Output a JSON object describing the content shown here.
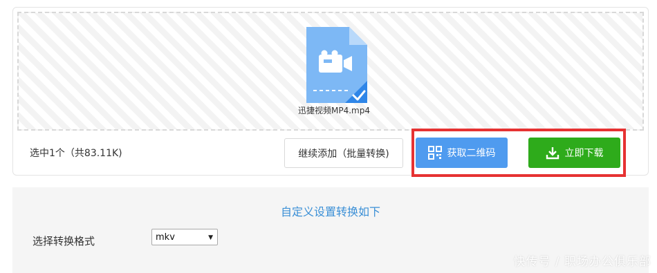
{
  "file": {
    "name": "迅捷视频MP4.mp4",
    "icon": "video-file-icon"
  },
  "status": {
    "selected_text": "选中1个（共83.11K)"
  },
  "buttons": {
    "add_more": "继续添加（批量转换)",
    "qr_code": "获取二维码",
    "download": "立即下载"
  },
  "settings": {
    "title": "自定义设置转换如下",
    "format_label": "选择转换格式",
    "format_value": "mkv"
  },
  "watermark": "快传号 / 职场办公俱乐部",
  "colors": {
    "qr_button": "#4f9bef",
    "download_button": "#2eab1b",
    "highlight": "#e63232",
    "title": "#3a8fd6"
  }
}
